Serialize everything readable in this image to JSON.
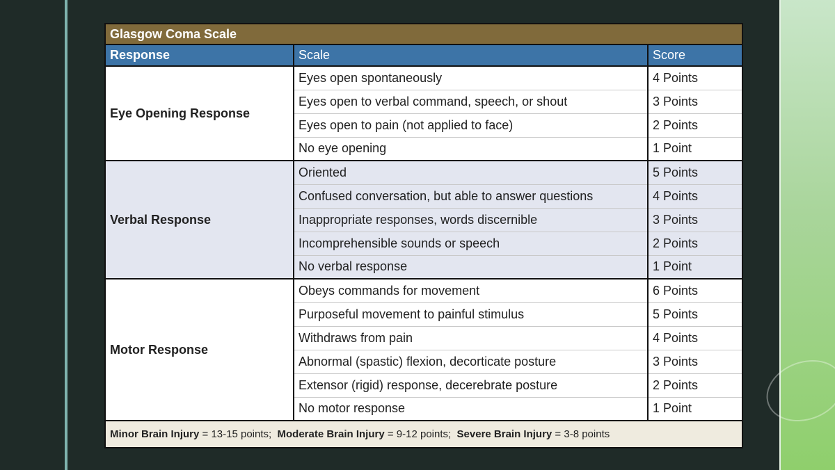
{
  "table": {
    "title": "Glasgow Coma Scale",
    "headers": {
      "response": "Response",
      "scale": "Scale",
      "score": "Score"
    },
    "groups": [
      {
        "name": "Eye Opening Response",
        "rows": [
          {
            "scale": "Eyes open spontaneously",
            "score": "4 Points"
          },
          {
            "scale": "Eyes open to verbal command, speech, or shout",
            "score": "3 Points"
          },
          {
            "scale": "Eyes open to pain (not applied to face)",
            "score": "2 Points"
          },
          {
            "scale": "No eye opening",
            "score": "1 Point"
          }
        ]
      },
      {
        "name": "Verbal Response",
        "rows": [
          {
            "scale": "Oriented",
            "score": "5 Points"
          },
          {
            "scale": "Confused conversation, but able to answer questions",
            "score": "4 Points"
          },
          {
            "scale": "Inappropriate responses, words discernible",
            "score": "3 Points"
          },
          {
            "scale": "Incomprehensible sounds or speech",
            "score": "2 Points"
          },
          {
            "scale": "No verbal response",
            "score": "1 Point"
          }
        ]
      },
      {
        "name": "Motor Response",
        "rows": [
          {
            "scale": "Obeys commands for movement",
            "score": "6 Points"
          },
          {
            "scale": "Purposeful movement to painful stimulus",
            "score": "5 Points"
          },
          {
            "scale": "Withdraws from pain",
            "score": "4 Points"
          },
          {
            "scale": "Abnormal (spastic) flexion, decorticate posture",
            "score": "3 Points"
          },
          {
            "scale": "Extensor (rigid) response, decerebrate posture",
            "score": "2 Points"
          },
          {
            "scale": "No motor response",
            "score": "1 Point"
          }
        ]
      }
    ],
    "legend": {
      "minor_label": "Minor Brain Injury",
      "minor_value": " = 13-15 points;  ",
      "moderate_label": "Moderate Brain Injury",
      "moderate_value": " = 9-12 points;  ",
      "severe_label": "Severe Brain Injury",
      "severe_value": " = 3-8 points"
    }
  }
}
